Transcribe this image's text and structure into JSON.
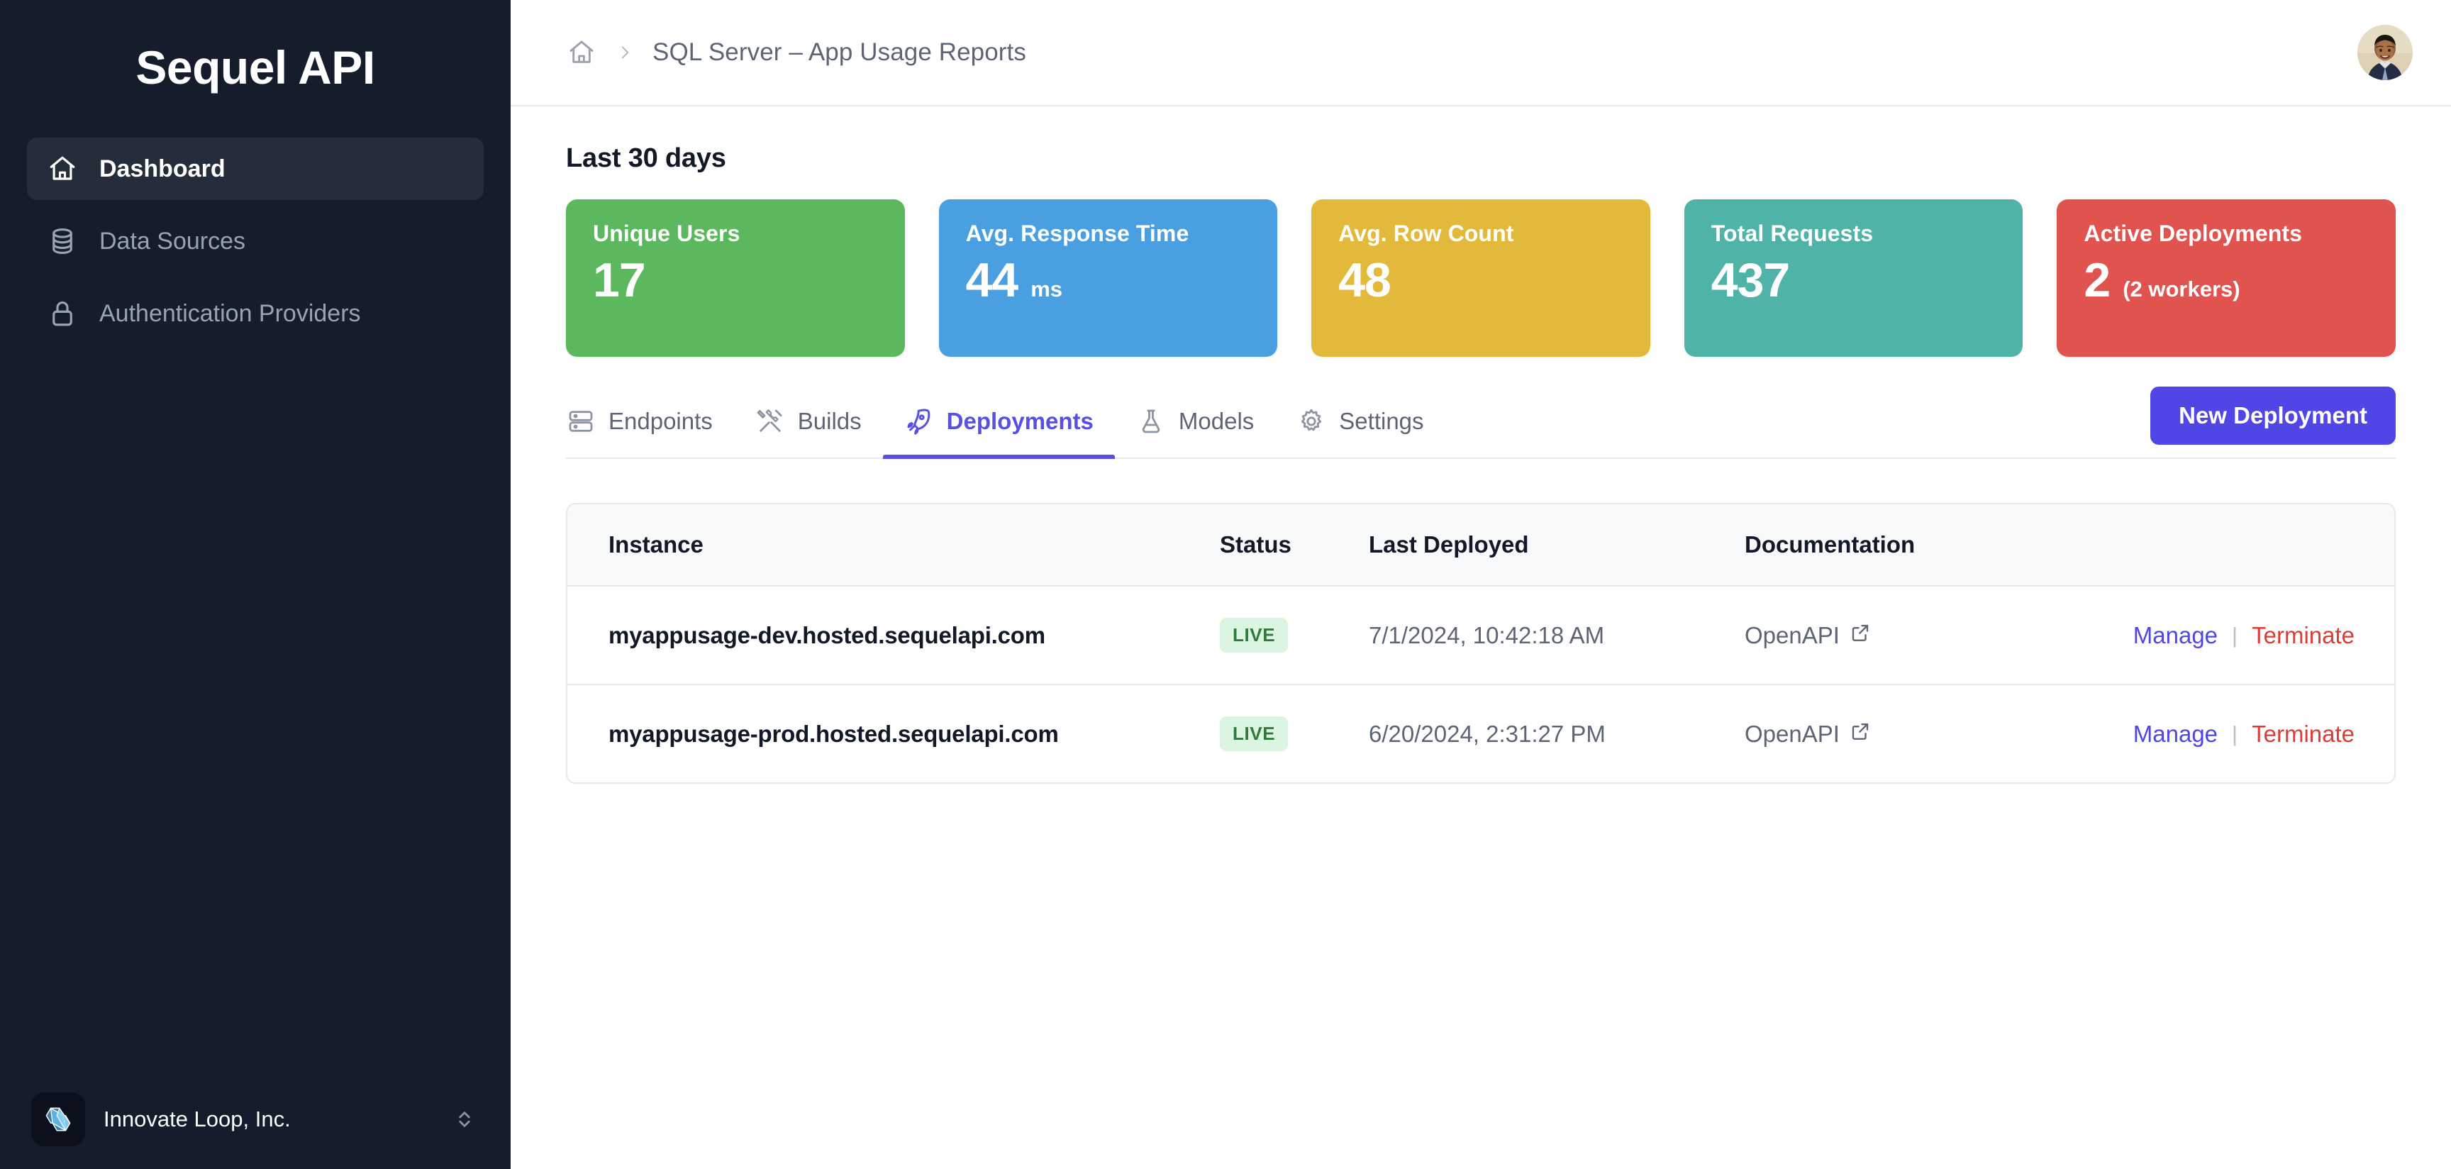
{
  "sidebar": {
    "brand": "Sequel API",
    "items": [
      {
        "label": "Dashboard",
        "icon": "home-icon",
        "active": true
      },
      {
        "label": "Data Sources",
        "icon": "database-icon",
        "active": false
      },
      {
        "label": "Authentication Providers",
        "icon": "lock-icon",
        "active": false
      }
    ],
    "org": {
      "name": "Innovate Loop, Inc.",
      "logo_icon": "infinity-loop-logo",
      "switch_icon": "chevron-up-down-icon"
    }
  },
  "topbar": {
    "home_icon": "home-icon",
    "separator_icon": "chevron-right-icon",
    "breadcrumb_title": "SQL Server – App Usage Reports",
    "avatar_icon": "user-avatar"
  },
  "main": {
    "section_title": "Last 30 days",
    "cards": [
      {
        "label": "Unique Users",
        "value": "17",
        "suffix": "",
        "color": "#5cb85f"
      },
      {
        "label": "Avg. Response Time",
        "value": "44",
        "suffix": "ms",
        "color": "#4a9fe0"
      },
      {
        "label": "Avg. Row Count",
        "value": "48",
        "suffix": "",
        "color": "#e2b93b"
      },
      {
        "label": "Total Requests",
        "value": "437",
        "suffix": "",
        "color": "#4fb3a8"
      },
      {
        "label": "Active Deployments",
        "value": "2",
        "suffix": "(2 workers)",
        "color": "#e0534e"
      }
    ],
    "tabs": [
      {
        "label": "Endpoints",
        "icon": "server-icon",
        "active": false
      },
      {
        "label": "Builds",
        "icon": "tools-icon",
        "active": false
      },
      {
        "label": "Deployments",
        "icon": "rocket-icon",
        "active": true
      },
      {
        "label": "Models",
        "icon": "flask-icon",
        "active": false
      },
      {
        "label": "Settings",
        "icon": "gear-icon",
        "active": false
      }
    ],
    "new_deployment_label": "New Deployment",
    "table": {
      "columns": [
        "Instance",
        "Status",
        "Last Deployed",
        "Documentation",
        ""
      ],
      "rows": [
        {
          "instance": "myappusage-dev.hosted.sequelapi.com",
          "status": "LIVE",
          "last_deployed": "7/1/2024, 10:42:18 AM",
          "documentation": "OpenAPI",
          "doc_icon": "external-link-icon",
          "manage": "Manage",
          "separator": "|",
          "terminate": "Terminate"
        },
        {
          "instance": "myappusage-prod.hosted.sequelapi.com",
          "status": "LIVE",
          "last_deployed": "6/20/2024, 2:31:27 PM",
          "documentation": "OpenAPI",
          "doc_icon": "external-link-icon",
          "manage": "Manage",
          "separator": "|",
          "terminate": "Terminate"
        }
      ]
    }
  },
  "colors": {
    "accent": "#4f46e5",
    "sidebar_bg": "#151c2c",
    "sidebar_active_bg": "#252c3a",
    "badge_bg": "#dcf5e0",
    "badge_text": "#2f7a3d",
    "danger": "#e03a34"
  }
}
